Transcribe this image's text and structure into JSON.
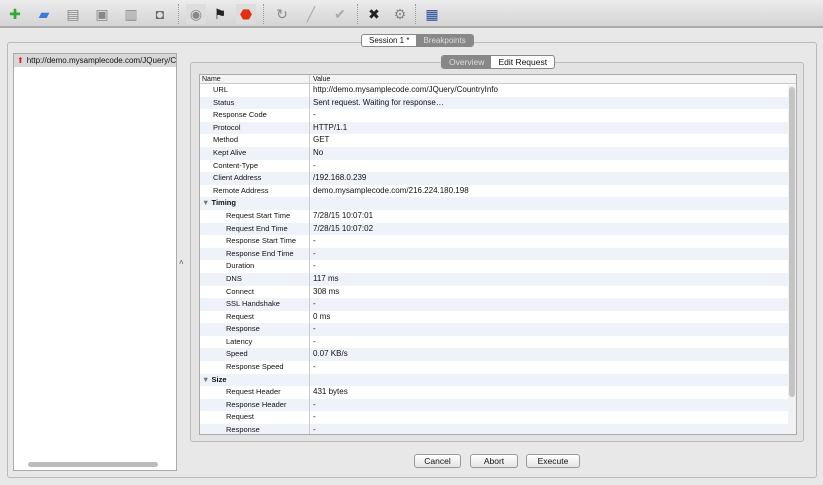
{
  "toolbar": {
    "icons": [
      "new-session-icon",
      "open-session-icon",
      "close-session-icon",
      "save-session-icon",
      "clear-session-icon",
      "find-icon",
      "record-icon",
      "throttle-icon",
      "breakpoints-icon",
      "repeat-icon",
      "edit-icon",
      "validate-icon",
      "tools-icon",
      "settings-icon",
      "shop-icon"
    ]
  },
  "session_tabs": [
    {
      "label": "Session 1 *"
    },
    {
      "label": "Breakpoints"
    }
  ],
  "tree": {
    "item": "http://demo.mysamplecode.com/JQuery/C"
  },
  "detail_tabs": [
    {
      "label": "Overview"
    },
    {
      "label": "Edit Request"
    }
  ],
  "table": {
    "headers": [
      "Name",
      "Value"
    ],
    "rows": [
      {
        "name": "URL",
        "value": "http://demo.mysamplecode.com/JQuery/CountryInfo",
        "kind": "top"
      },
      {
        "name": "Status",
        "value": "Sent request. Waiting for response…",
        "kind": "top"
      },
      {
        "name": "Response Code",
        "value": "-",
        "kind": "top"
      },
      {
        "name": "Protocol",
        "value": "HTTP/1.1",
        "kind": "top"
      },
      {
        "name": "Method",
        "value": "GET",
        "kind": "top"
      },
      {
        "name": "Kept Alive",
        "value": "No",
        "kind": "top"
      },
      {
        "name": "Content-Type",
        "value": "-",
        "kind": "top"
      },
      {
        "name": "Client Address",
        "value": "/192.168.0.239",
        "kind": "top"
      },
      {
        "name": "Remote Address",
        "value": "demo.mysamplecode.com/216.224.180.198",
        "kind": "top"
      },
      {
        "name": "Timing",
        "value": "",
        "kind": "grp"
      },
      {
        "name": "Request Start Time",
        "value": "7/28/15 10:07:01",
        "kind": "sub"
      },
      {
        "name": "Request End Time",
        "value": "7/28/15 10:07:02",
        "kind": "sub"
      },
      {
        "name": "Response Start Time",
        "value": "-",
        "kind": "sub"
      },
      {
        "name": "Response End Time",
        "value": "-",
        "kind": "sub"
      },
      {
        "name": "Duration",
        "value": "-",
        "kind": "sub"
      },
      {
        "name": "DNS",
        "value": "117 ms",
        "kind": "sub"
      },
      {
        "name": "Connect",
        "value": "308 ms",
        "kind": "sub"
      },
      {
        "name": "SSL Handshake",
        "value": "-",
        "kind": "sub"
      },
      {
        "name": "Request",
        "value": "0 ms",
        "kind": "sub"
      },
      {
        "name": "Response",
        "value": "-",
        "kind": "sub"
      },
      {
        "name": "Latency",
        "value": "-",
        "kind": "sub"
      },
      {
        "name": "Speed",
        "value": "0.07 KB/s",
        "kind": "sub"
      },
      {
        "name": "Response Speed",
        "value": "-",
        "kind": "sub"
      },
      {
        "name": "Size",
        "value": "",
        "kind": "grp"
      },
      {
        "name": "Request Header",
        "value": "431 bytes",
        "kind": "sub"
      },
      {
        "name": "Response Header",
        "value": "-",
        "kind": "sub"
      },
      {
        "name": "Request",
        "value": "-",
        "kind": "sub"
      },
      {
        "name": "Response",
        "value": "-",
        "kind": "sub"
      }
    ]
  },
  "buttons": {
    "cancel": "Cancel",
    "abort": "Abort",
    "execute": "Execute"
  }
}
